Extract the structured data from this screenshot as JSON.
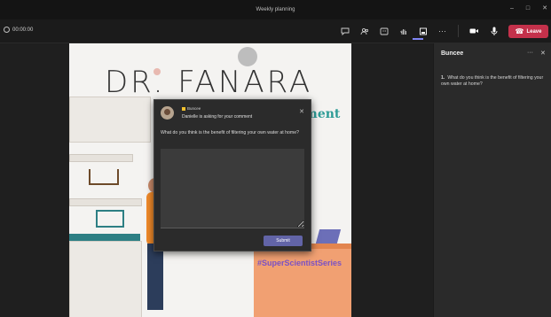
{
  "window": {
    "title": "Weekly planning"
  },
  "toolbar": {
    "timer": "00:00:00",
    "tools": [
      "chat",
      "people",
      "reactions",
      "raise-hand",
      "apps",
      "more"
    ],
    "leave_label": "Leave",
    "leave_color": "#c4314b",
    "accent": "#7f85f5"
  },
  "slide": {
    "heading": "DR. FANARA",
    "subtitle": "ment",
    "hashtag": "#SuperScientistSeries"
  },
  "dialog": {
    "app_name": "Buncee",
    "message": "Danielle is asking for your comment",
    "question": "What do you think is the benefit of filtering your own water at home?",
    "answer_value": "",
    "submit_label": "Submit",
    "submit_color": "#6264a7"
  },
  "panel": {
    "title": "Buncee",
    "question_number": "1.",
    "question": "What do you think is the benefit of filtering your own water at home?"
  }
}
